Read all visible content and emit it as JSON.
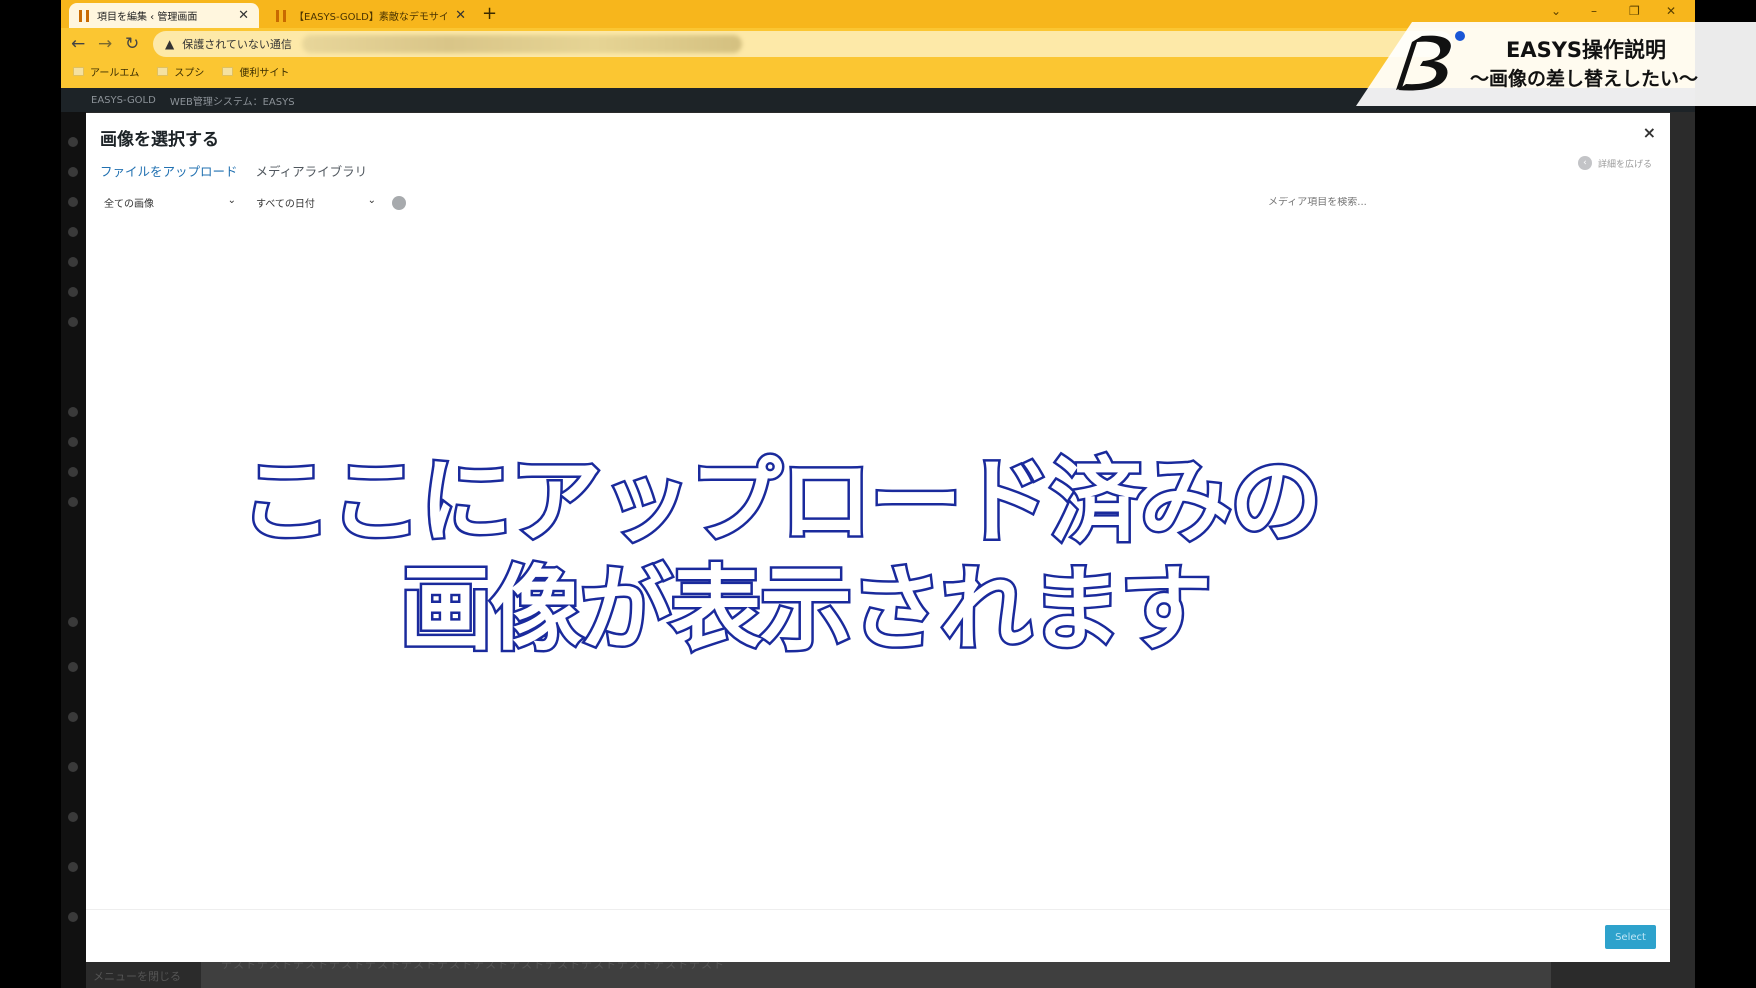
{
  "browser": {
    "tabs": [
      {
        "title": "項目を編集 ‹ 管理画面",
        "close": "✕"
      },
      {
        "title": "【EASYS-GOLD】素敵なデモサイト",
        "close": "✕"
      }
    ],
    "new_tab_icon": "+",
    "window_controls": [
      "⌄",
      "–",
      "❐",
      "✕"
    ],
    "nav": {
      "back": "←",
      "forward": "→",
      "reload": "↻"
    },
    "address": {
      "warning_icon": "▲",
      "security_text": "保護されていない通信"
    },
    "bookmarks": [
      "アールエム",
      "スプシ",
      "便利サイト"
    ]
  },
  "admin": {
    "bar": [
      "EASYS-GOLD",
      "WEB管理システム：EASYS"
    ],
    "content_text": "テストテストテストテストテストテストテストテストテストテストテストテストテストテスト",
    "menu_close_label": "メニューを閉じる"
  },
  "modal": {
    "title": "画像を選択する",
    "close": "×",
    "router": [
      {
        "label": "ファイルをアップロード",
        "active": true
      },
      {
        "label": "メディアライブラリ",
        "active": false
      }
    ],
    "expand_label": "詳細を広げる",
    "filters": {
      "type": "全ての画像",
      "date": "すべての日付"
    },
    "search_placeholder": "メディア項目を検索...",
    "select_button": "Select"
  },
  "overlay": {
    "caption_line1": "ここにアップロード済みの",
    "caption_line2": "画像が表示されます",
    "brand_title": "EASYS操作説明",
    "brand_subtitle": "〜画像の差し替えしたい〜"
  },
  "colors": {
    "tab_bar": "#f7b61c",
    "wp_link": "#2271b1",
    "select_button": "#2ea2cc",
    "caption_stroke": "#1a2a9c"
  }
}
